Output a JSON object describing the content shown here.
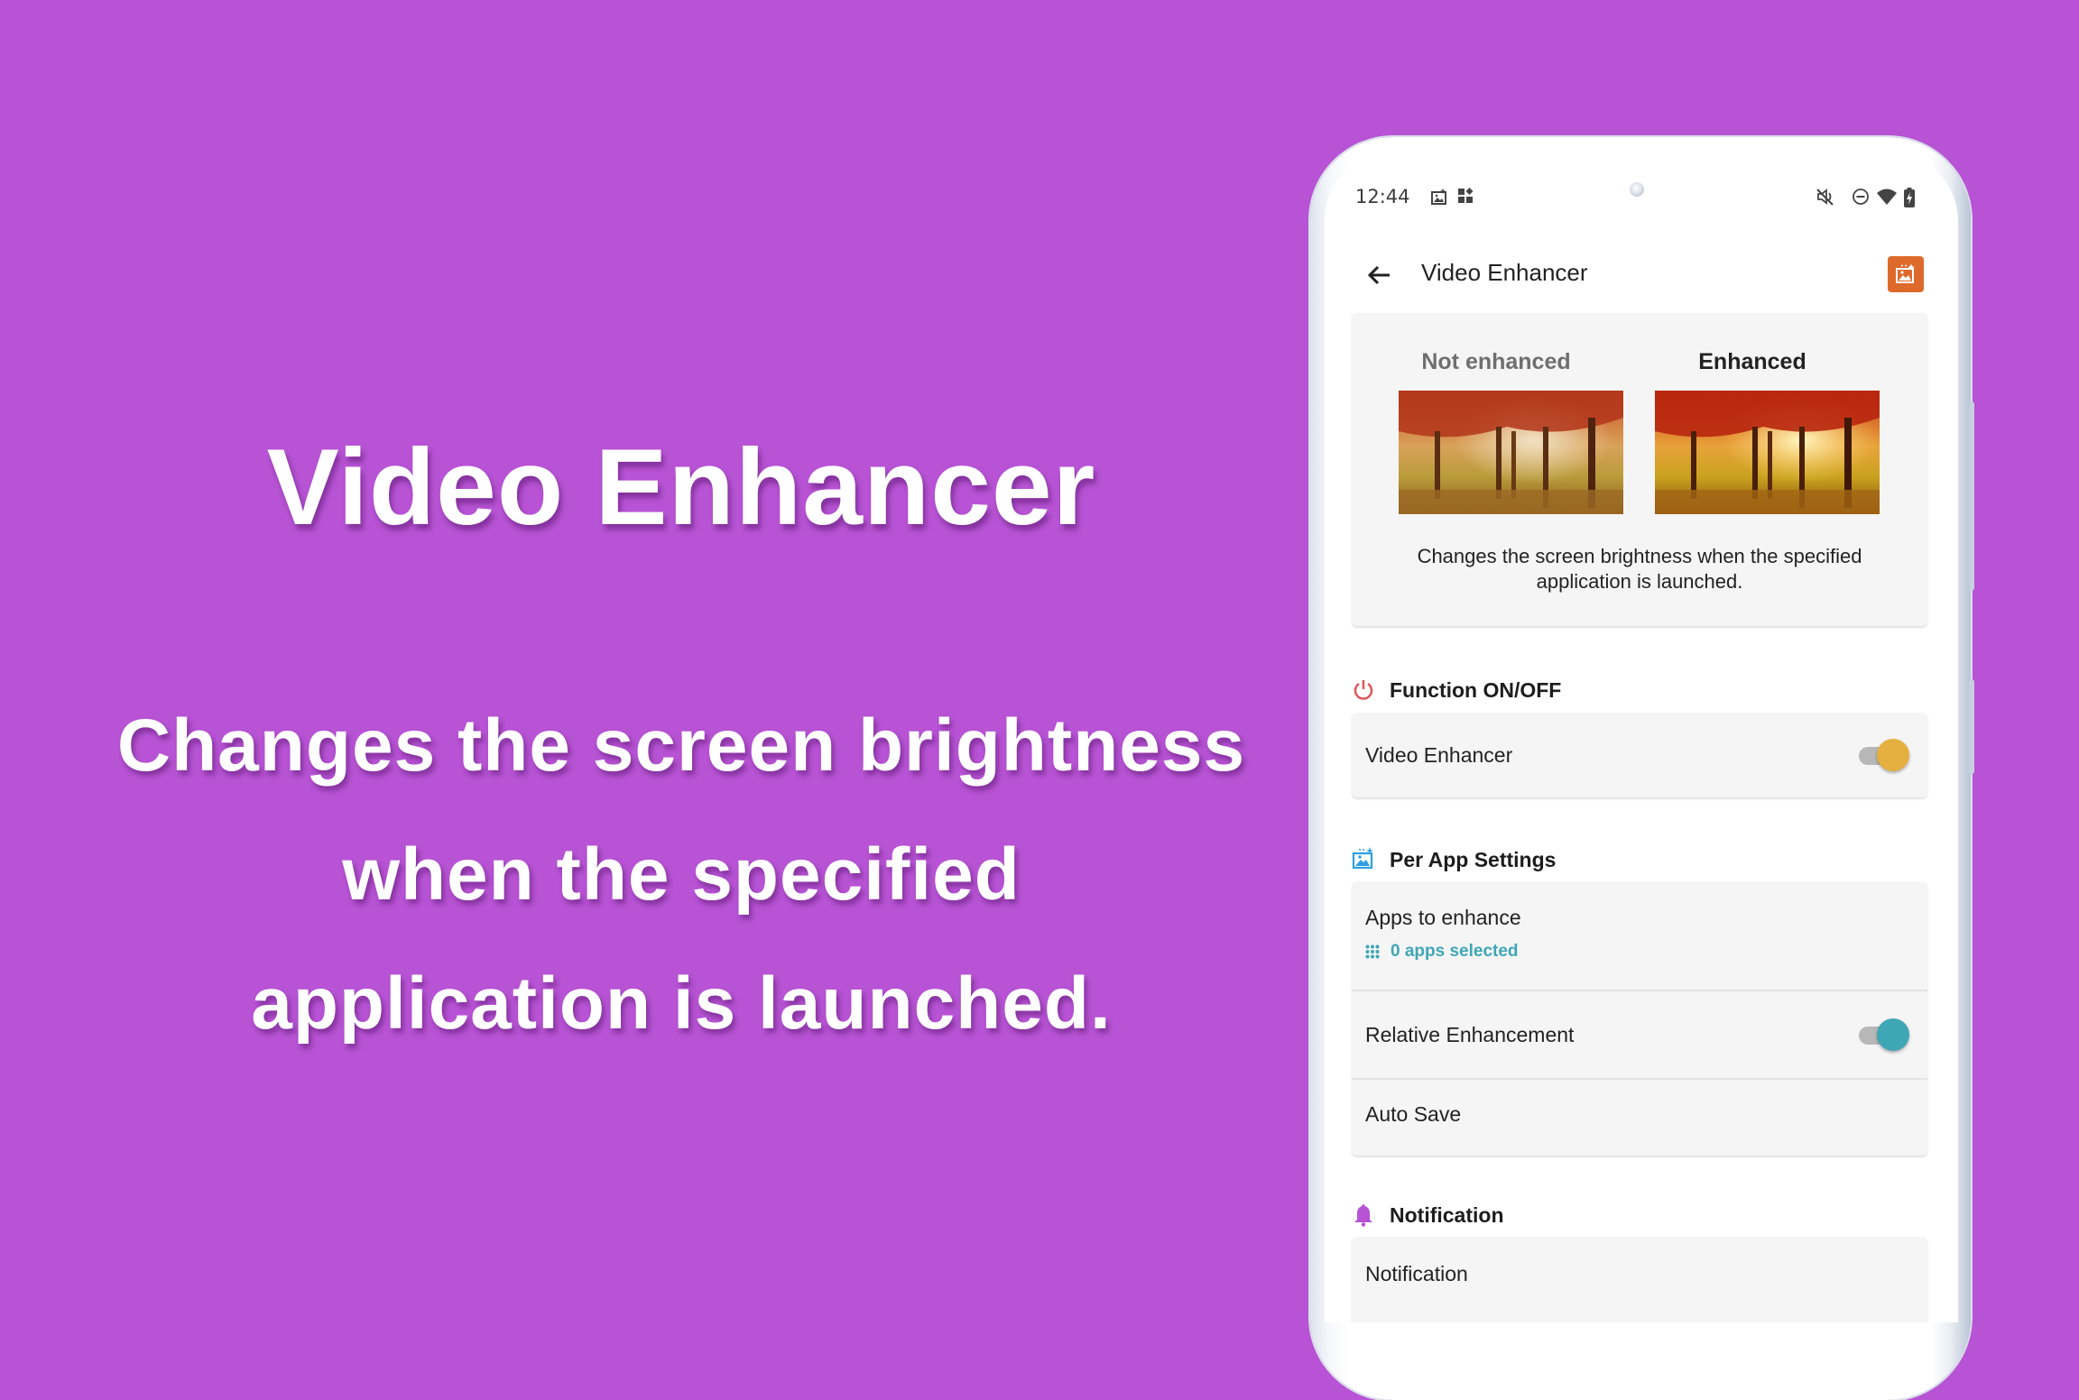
{
  "promo": {
    "title": "Video Enhancer",
    "subtitle_lines": [
      "Changes the screen brightness",
      "when the specified",
      "application is launched."
    ]
  },
  "colors": {
    "background": "#b753d4",
    "action_orange": "#dd6a2b",
    "toggle_on_yellow": "#e6b040",
    "toggle_on_teal": "#3fa6b6",
    "teal_text": "#3fa6b6",
    "power_red": "#e0565a",
    "bell_purple": "#b753d4",
    "image_blue": "#2e9fe3"
  },
  "status_bar": {
    "time": "12:44",
    "left_icons": [
      "gallery-sparkle-icon",
      "widgets-icon"
    ],
    "right_icons": [
      "mute-vibrate-off-icon",
      "do-not-disturb-icon",
      "wifi-icon",
      "battery-charging-icon"
    ]
  },
  "app_bar": {
    "back_icon": "arrow-back-icon",
    "title": "Video Enhancer",
    "action_icon": "image-sparkle-icon"
  },
  "hero": {
    "label_before": "Not enhanced",
    "label_after": "Enhanced",
    "description": "Changes the screen brightness when the specified application is launched."
  },
  "sections": {
    "function": {
      "icon": "power-icon",
      "title": "Function ON/OFF",
      "items": [
        {
          "label": "Video Enhancer",
          "toggle": true
        }
      ]
    },
    "per_app": {
      "icon": "image-sparkle-icon",
      "title": "Per App Settings",
      "items": [
        {
          "label": "Apps to enhance",
          "value": "0 apps selected",
          "value_icon": "apps-grid-icon"
        },
        {
          "label": "Relative Enhancement",
          "toggle": true
        },
        {
          "label": "Auto Save"
        }
      ]
    },
    "notification": {
      "icon": "bell-icon",
      "title": "Notification",
      "items": [
        {
          "label": "Notification"
        }
      ]
    }
  }
}
